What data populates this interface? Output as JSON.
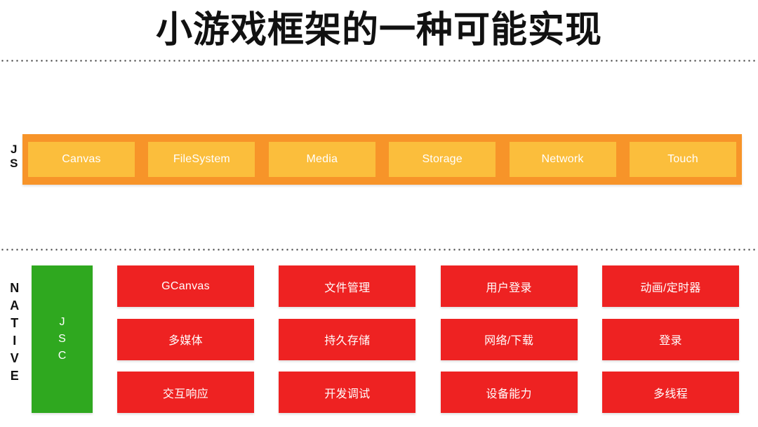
{
  "title": "小游戏框架的一种可能实现",
  "colors": {
    "js_bar_background": "#F79429",
    "js_tile_background": "#FBBE3C",
    "jsc_background": "#2FA81F",
    "native_cell_background": "#EE2222",
    "title_text": "#111111",
    "divider": "#3C3C3C"
  },
  "js_layer": {
    "label_lines": [
      "J",
      "S"
    ],
    "modules": [
      {
        "label": "Canvas"
      },
      {
        "label": "FileSystem"
      },
      {
        "label": "Media"
      },
      {
        "label": "Storage"
      },
      {
        "label": "Network"
      },
      {
        "label": "Touch"
      }
    ]
  },
  "native_layer": {
    "label_lines": [
      "N",
      "A",
      "T",
      "I",
      "V",
      "E"
    ],
    "engine": {
      "label_lines": [
        "J",
        "S",
        "C"
      ]
    },
    "columns": [
      {
        "cells": [
          {
            "label": "GCanvas"
          },
          {
            "label": "多媒体"
          },
          {
            "label": "交互响应"
          }
        ]
      },
      {
        "cells": [
          {
            "label": "文件管理"
          },
          {
            "label": "持久存储"
          },
          {
            "label": "开发调试"
          }
        ]
      },
      {
        "cells": [
          {
            "label": "用户登录"
          },
          {
            "label": "网络/下载"
          },
          {
            "label": "设备能力"
          }
        ]
      },
      {
        "cells": [
          {
            "label": "动画/定时器"
          },
          {
            "label": "登录"
          },
          {
            "label": "多线程"
          }
        ]
      }
    ]
  }
}
